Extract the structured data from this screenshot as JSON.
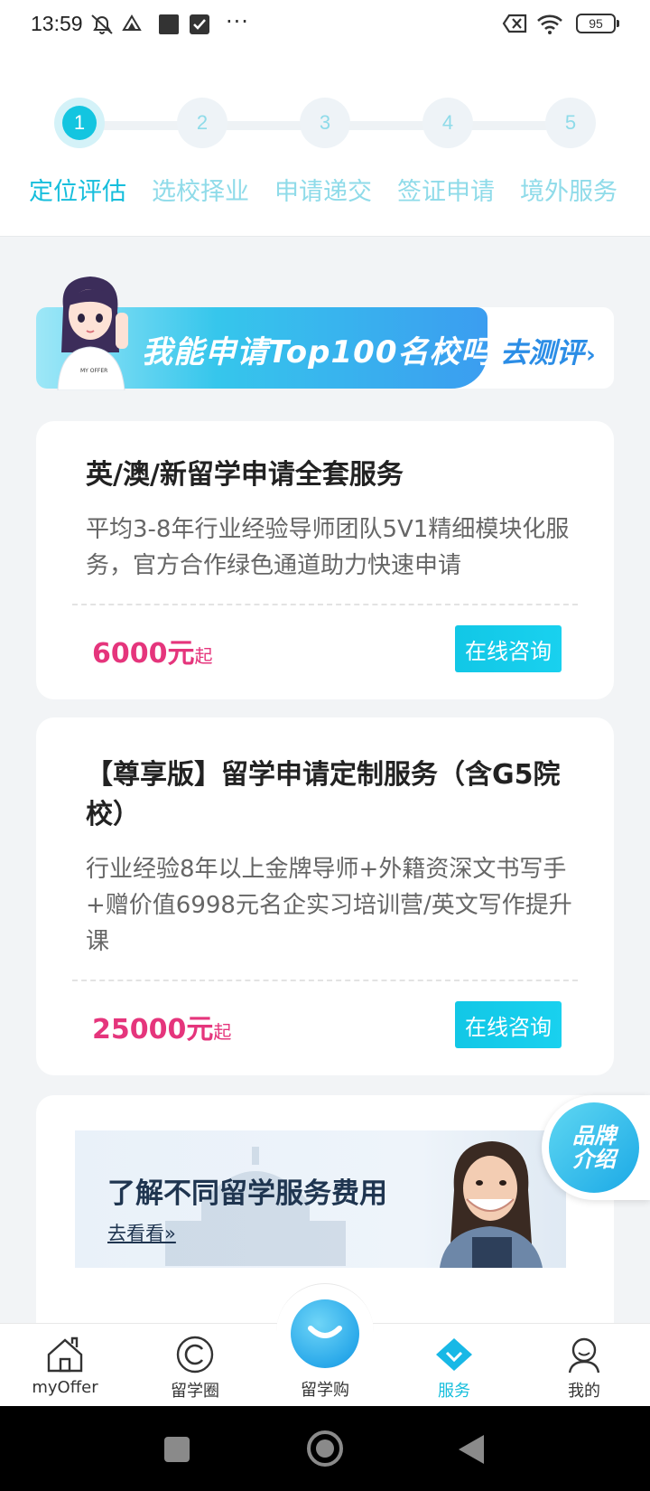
{
  "status_bar": {
    "time": "13:59",
    "battery": "95",
    "icons": [
      "mute-icon",
      "drive-icon",
      "square-icon",
      "check-icon",
      "more-icon",
      "sim-off-icon",
      "wifi-icon",
      "battery-icon"
    ],
    "more": "···"
  },
  "stepper": {
    "steps": [
      {
        "number": "1",
        "label": "定位评估",
        "active": true
      },
      {
        "number": "2",
        "label": "选校择业",
        "active": false
      },
      {
        "number": "3",
        "label": "申请递交",
        "active": false
      },
      {
        "number": "4",
        "label": "签证申请",
        "active": false
      },
      {
        "number": "5",
        "label": "境外服务",
        "active": false
      }
    ]
  },
  "promo": {
    "text": "我能申请Top100名校吗",
    "cta": "去测评",
    "cta_chevron": "›",
    "shirt_text": "MY OFFER"
  },
  "cards": [
    {
      "title": "英/澳/新留学申请全套服务",
      "description": "平均3-8年行业经验导师团队5V1精细模块化服务，官方合作绿色通道助力快速申请",
      "price": "6000元",
      "price_suffix": "起",
      "button": "在线咨询"
    },
    {
      "title": "【尊享版】留学申请定制服务（含G5院校）",
      "description": "行业经验8年以上金牌导师+外籍资深文书写手+赠价值6998元名企实习培训营/英文写作提升课",
      "price": "25000元",
      "price_suffix": "起",
      "button": "在线咨询"
    }
  ],
  "fees_banner": {
    "title": "了解不同留学服务费用",
    "link": "去看看",
    "link_arrow": "»"
  },
  "brand_fab": {
    "line1": "品牌",
    "line2": "介绍"
  },
  "bottom_nav": {
    "items": [
      {
        "label": "myOffer",
        "icon": "home-icon"
      },
      {
        "label": "留学圈",
        "icon": "circle-icon"
      },
      {
        "label": "留学购",
        "icon": "smile-ball-icon"
      },
      {
        "label": "服务",
        "icon": "diamond-icon",
        "active": true
      },
      {
        "label": "我的",
        "icon": "profile-icon"
      }
    ]
  },
  "colors": {
    "accent": "#16bedc",
    "price": "#e5357c",
    "inactive_step": "#8fdbe9"
  }
}
